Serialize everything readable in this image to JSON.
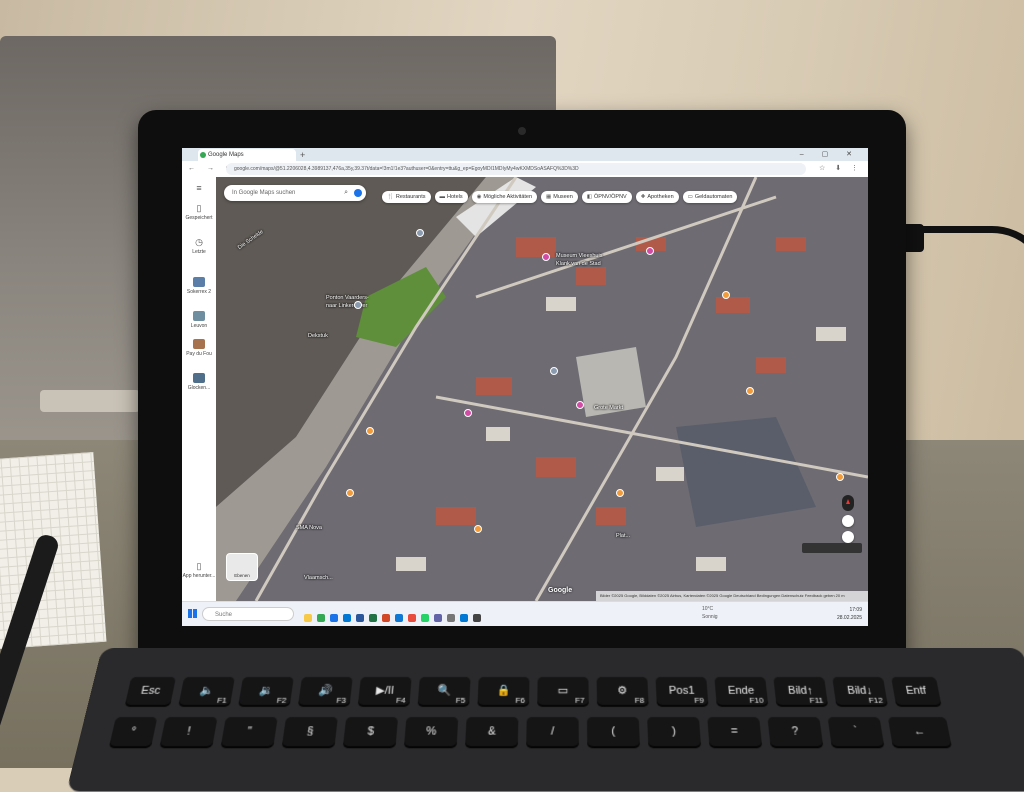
{
  "browser": {
    "tab_title": "Google Maps",
    "new_tab": "+",
    "url": "google.com/maps/@51.2206028,4.3989137,476a,35y,39.37t/data=!3m1!1e3?authuser=0&entry=ttu&g_ep=EgoyMDI1MDIyMy4wKXMDSoASAFQ%3D%3D"
  },
  "rail": {
    "items": [
      {
        "label": "Gespeichert",
        "icon": "bookmark-icon"
      },
      {
        "label": "Letzte",
        "icon": "history-icon"
      },
      {
        "label": "Sokerrex 2",
        "icon": "thumbnail"
      },
      {
        "label": "Leuvon",
        "icon": "thumbnail"
      },
      {
        "label": "Pay du Fou",
        "icon": "thumbnail"
      },
      {
        "label": "Glocken...",
        "icon": "thumbnail"
      },
      {
        "label": "App herunter...",
        "icon": "phone-icon"
      }
    ]
  },
  "map": {
    "search_placeholder": "In Google Maps suchen",
    "chips": [
      {
        "label": "Restaurants",
        "icon": "fork-knife-icon"
      },
      {
        "label": "Hotels",
        "icon": "bed-icon"
      },
      {
        "label": "Mögliche Aktivitäten",
        "icon": "camera-icon"
      },
      {
        "label": "Museen",
        "icon": "museum-icon"
      },
      {
        "label": "ÖPNV/ÖPNV",
        "icon": "transit-icon"
      },
      {
        "label": "Apotheken",
        "icon": "pill-icon"
      },
      {
        "label": "Geldautomaten",
        "icon": "atm-icon"
      }
    ],
    "labels": {
      "river": "Die Schelde",
      "ponton": "Ponton Vaarders-",
      "ponton2": "naar Linkeroever",
      "dock": "Dekstuk",
      "museum": "Museum Vleeshuis",
      "museum2": "Klank van de Stad",
      "square": "Grote Markt",
      "sma": "SMA Nova",
      "vlaamsch": "Vlaamsch...",
      "plattel": "Plat..."
    },
    "layer_button": "Ebenen",
    "logo": "Google",
    "attribution": "Bilder ©2025 Google, Bilddaten ©2025 Airbus, Kartendaten ©2025 Google   Deutschland   Bedingungen   Datenschutz   Feedback geben   20 m"
  },
  "taskbar": {
    "search_placeholder": "Suche",
    "weather_temp": "10°C",
    "weather_desc": "Sonnig",
    "time": "17:09",
    "date": "28.02.2025"
  },
  "keyboard": {
    "row1": [
      {
        "label": "Esc",
        "fn": ""
      },
      {
        "label": "🔈",
        "fn": "F1"
      },
      {
        "label": "🔉",
        "fn": "F2"
      },
      {
        "label": "🔊",
        "fn": "F3"
      },
      {
        "label": "▶/II",
        "fn": "F4"
      },
      {
        "label": "🔍",
        "fn": "F5"
      },
      {
        "label": "🔒",
        "fn": "F6"
      },
      {
        "label": "▭",
        "fn": "F7"
      },
      {
        "label": "⚙",
        "fn": "F8"
      },
      {
        "label": "Pos1",
        "fn": "F9"
      },
      {
        "label": "Ende",
        "fn": "F10"
      },
      {
        "label": "Bild↑",
        "fn": "F11"
      },
      {
        "label": "Bild↓",
        "fn": "F12"
      },
      {
        "label": "Entf",
        "fn": ""
      }
    ],
    "row2": [
      {
        "label": "°",
        "fn": ""
      },
      {
        "label": "!",
        "fn": ""
      },
      {
        "label": "\"",
        "fn": ""
      },
      {
        "label": "§",
        "fn": ""
      },
      {
        "label": "$",
        "fn": ""
      },
      {
        "label": "%",
        "fn": ""
      },
      {
        "label": "&",
        "fn": ""
      },
      {
        "label": "/",
        "fn": ""
      },
      {
        "label": "(",
        "fn": ""
      },
      {
        "label": ")",
        "fn": ""
      },
      {
        "label": "=",
        "fn": ""
      },
      {
        "label": "?",
        "fn": ""
      },
      {
        "label": "`",
        "fn": ""
      },
      {
        "label": "←",
        "fn": ""
      }
    ]
  },
  "colors": {
    "accent": "#1a73e8",
    "pin_pink": "#d24ba5",
    "pin_orange": "#f29b3a",
    "rooftop": "#b05a4a"
  }
}
